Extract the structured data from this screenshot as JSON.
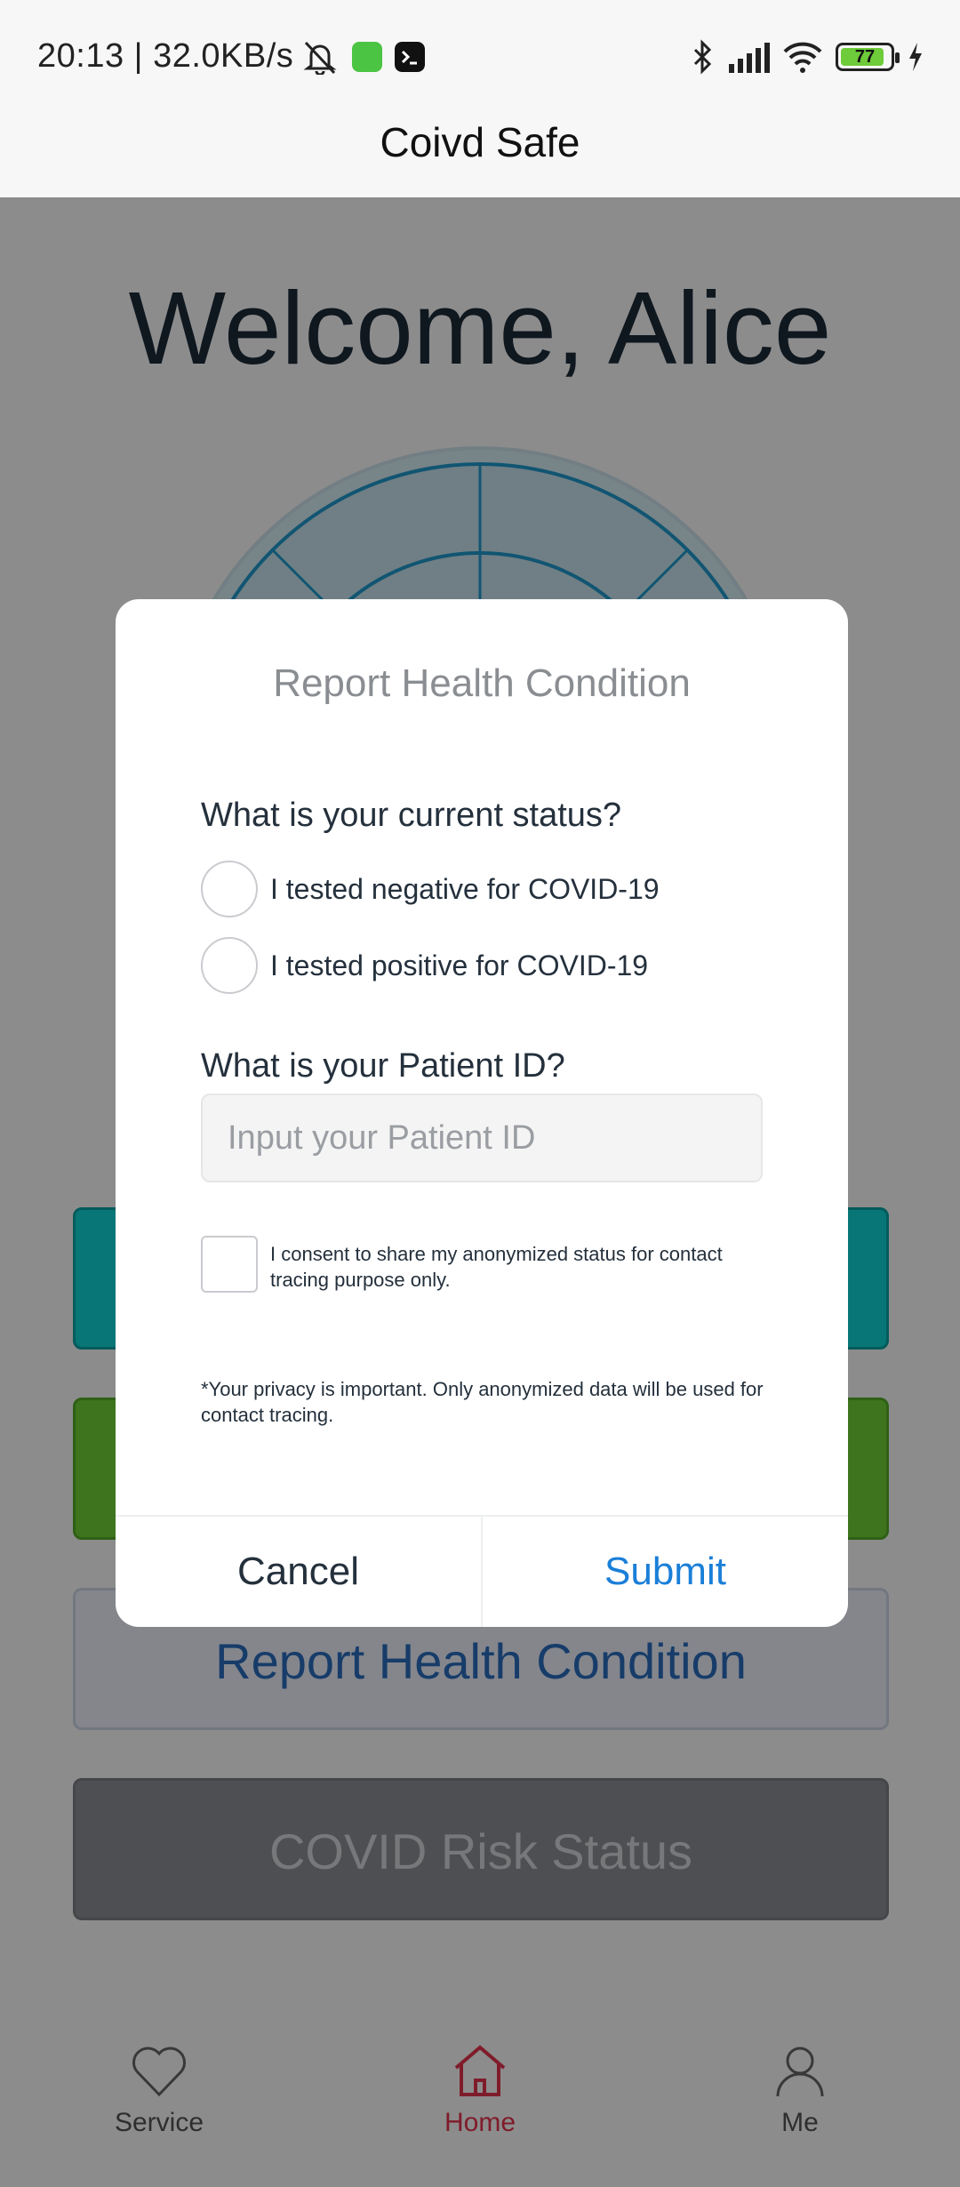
{
  "status_bar": {
    "time": "20:13 | 32.0KB/s",
    "battery": "77",
    "icons": [
      "mute-bell-icon",
      "app-icon",
      "terminal-icon",
      "bluetooth-icon",
      "signal-icon",
      "wifi-icon",
      "battery-icon",
      "charging-icon"
    ],
    "colors": {
      "app_icon": "#4cc443",
      "terminal_icon": "#111111",
      "battery_fill": "#6ecb3a"
    }
  },
  "header": {
    "title": "Coivd Safe"
  },
  "main": {
    "welcome": "Welcome, Alice",
    "report_button": "Report Health Condition",
    "risk_button": "COVID Risk Status"
  },
  "dialog": {
    "title": "Report Health Condition",
    "status_question": "What is your current status?",
    "options": [
      "I tested negative for COVID-19",
      "I tested positive for COVID-19"
    ],
    "patient_question": "What is your Patient ID?",
    "patient_placeholder": "Input your Patient ID",
    "consent": "I consent to share my anonymized status for contact tracing purpose only.",
    "privacy": "*Your privacy is important. Only anonymized data will be used for contact tracing.",
    "cancel": "Cancel",
    "submit": "Submit"
  },
  "tabbar": {
    "items": [
      {
        "label": "Service",
        "icon": "heart-icon"
      },
      {
        "label": "Home",
        "icon": "home-icon"
      },
      {
        "label": "Me",
        "icon": "person-icon"
      }
    ],
    "active_color": "#e8344e"
  }
}
